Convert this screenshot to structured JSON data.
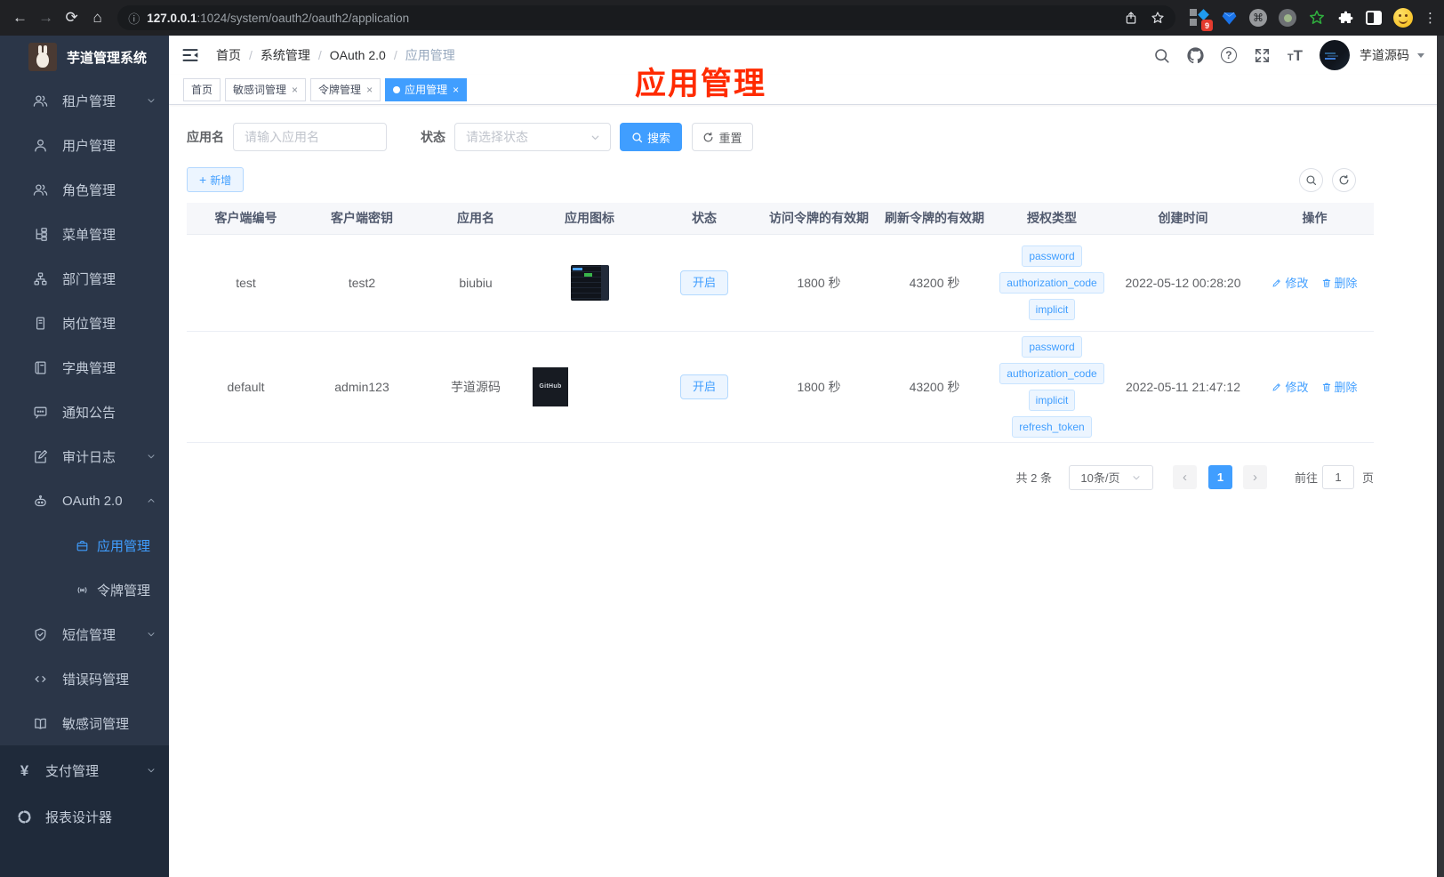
{
  "browser": {
    "url_host": "127.0.0.1",
    "url_rest": ":1024/system/oauth2/oauth2/application",
    "extension_badge": "9"
  },
  "sidebar": {
    "title": "芋道管理系统",
    "items": [
      {
        "label": "租户管理",
        "icon": "users",
        "arrow": "down"
      },
      {
        "label": "用户管理",
        "icon": "user"
      },
      {
        "label": "角色管理",
        "icon": "users"
      },
      {
        "label": "菜单管理",
        "icon": "tree"
      },
      {
        "label": "部门管理",
        "icon": "org"
      },
      {
        "label": "岗位管理",
        "icon": "badge"
      },
      {
        "label": "字典管理",
        "icon": "dict"
      },
      {
        "label": "通知公告",
        "icon": "message"
      },
      {
        "label": "审计日志",
        "icon": "log",
        "arrow": "down"
      },
      {
        "label": "OAuth 2.0",
        "icon": "robot",
        "arrow": "up"
      },
      {
        "label": "应用管理",
        "icon": "app",
        "nested": true,
        "active": true
      },
      {
        "label": "令牌管理",
        "icon": "token",
        "nested": true
      },
      {
        "label": "短信管理",
        "icon": "sms",
        "arrow": "down"
      },
      {
        "label": "错误码管理",
        "icon": "code"
      },
      {
        "label": "敏感词管理",
        "icon": "words"
      }
    ],
    "bottom_items": [
      {
        "label": "支付管理",
        "icon": "yen",
        "arrow": "down"
      },
      {
        "label": "报表设计器",
        "icon": "report"
      }
    ]
  },
  "navbar": {
    "breadcrumb": [
      "首页",
      "系统管理",
      "OAuth 2.0",
      "应用管理"
    ],
    "username": "芋道源码"
  },
  "tabs": [
    {
      "label": "首页",
      "closable": false,
      "active": false
    },
    {
      "label": "敏感词管理",
      "closable": true,
      "active": false
    },
    {
      "label": "令牌管理",
      "closable": true,
      "active": false
    },
    {
      "label": "应用管理",
      "closable": true,
      "active": true
    }
  ],
  "annotation": "应用管理",
  "filters": {
    "name_label": "应用名",
    "name_placeholder": "请输入应用名",
    "status_label": "状态",
    "status_placeholder": "请选择状态",
    "search_label": "搜索",
    "reset_label": "重置",
    "add_label": "新增"
  },
  "table": {
    "columns": [
      "客户端编号",
      "客户端密钥",
      "应用名",
      "应用图标",
      "状态",
      "访问令牌的有效期",
      "刷新令牌的有效期",
      "授权类型",
      "创建时间",
      "操作"
    ],
    "edit_label": "修改",
    "delete_label": "删除",
    "rows": [
      {
        "client_id": "test",
        "secret": "test2",
        "name": "biubiu",
        "icon_type": "dashboard",
        "icon_text": "",
        "status": "开启",
        "access_ttl": "1800 秒",
        "refresh_ttl": "43200 秒",
        "grants": [
          "password",
          "authorization_code",
          "implicit"
        ],
        "created": "2022-05-12 00:28:20"
      },
      {
        "client_id": "default",
        "secret": "admin123",
        "name": "芋道源码",
        "icon_type": "github",
        "icon_text": "GitHub",
        "status": "开启",
        "access_ttl": "1800 秒",
        "refresh_ttl": "43200 秒",
        "grants": [
          "password",
          "authorization_code",
          "implicit",
          "refresh_token"
        ],
        "created": "2022-05-11 21:47:12"
      }
    ]
  },
  "pagination": {
    "total": "共 2 条",
    "page_size": "10条/页",
    "current_page": "1",
    "goto_label": "前往",
    "goto_value": "1",
    "page_label": "页"
  },
  "colors": {
    "accent": "#409eff",
    "annotation_red": "#ff2b00",
    "sidebar_bg": "#2b3648",
    "sidebar_bottom_bg": "#1f2a3a"
  }
}
